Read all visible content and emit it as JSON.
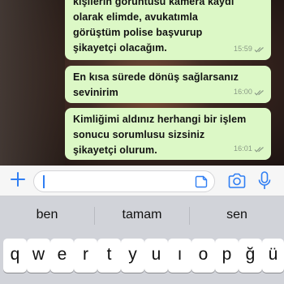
{
  "messages": [
    {
      "text": "kişilerin görüntüsü kamera kaydı\nolarak elimde, avukatımla\ngörüştüm polise başvurup\nşikayetçi olacağım.",
      "time": "15:59"
    },
    {
      "text": "En kısa sürede dönüş sağlarsanız\nsevinirim",
      "time": "16:00"
    },
    {
      "text": "Kimliğimi aldınız herhangi bir işlem\nsonucu sorumlusu sizsiniz\nşikayetçi olurum.",
      "time": "16:01"
    }
  ],
  "input": {
    "value": ""
  },
  "suggestions": [
    "ben",
    "tamam",
    "sen"
  ],
  "keyboard_row": [
    "q",
    "w",
    "e",
    "r",
    "t",
    "y",
    "u",
    "ı",
    "o",
    "p",
    "ğ",
    "ü"
  ],
  "colors": {
    "bubble": "#dcf8c6",
    "accent": "#2f7ef3",
    "tick": "#8a9a86"
  },
  "icons": [
    "plus-icon",
    "sticker-icon",
    "camera-icon",
    "microphone-icon",
    "double-check-icon"
  ]
}
